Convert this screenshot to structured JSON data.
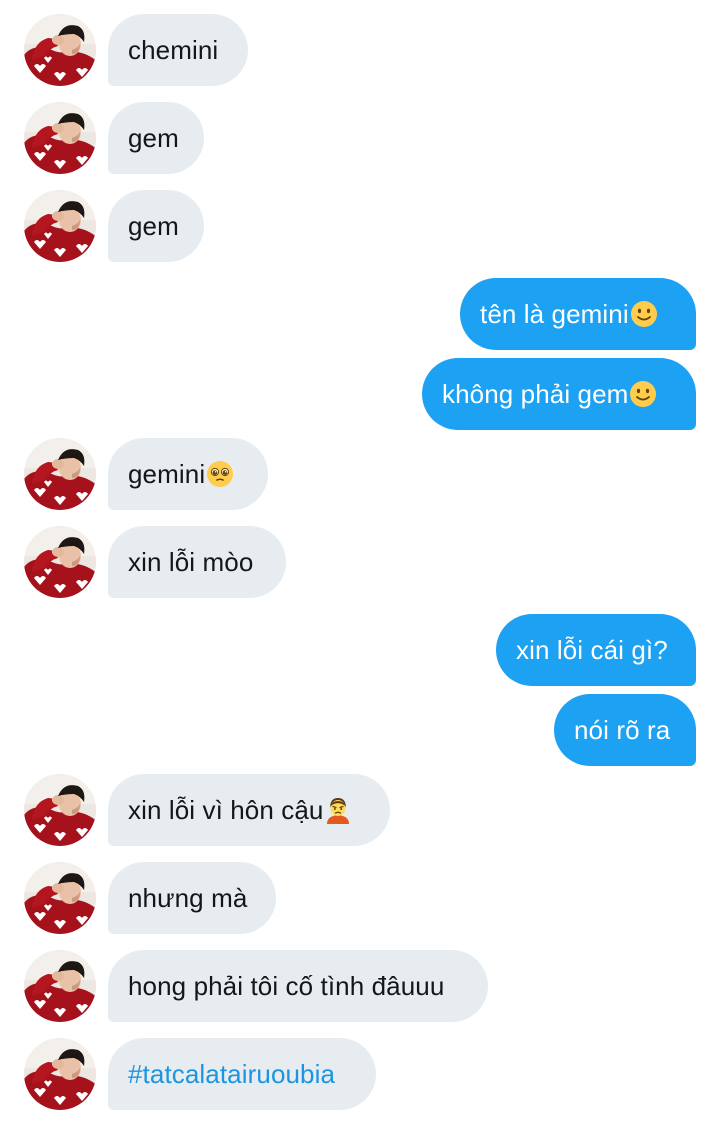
{
  "conversation": {
    "messages": [
      {
        "direction": "received",
        "text": "chemini",
        "emoji": ""
      },
      {
        "direction": "received",
        "text": "gem",
        "emoji": ""
      },
      {
        "direction": "received",
        "text": "gem",
        "emoji": ""
      },
      {
        "direction": "sent",
        "text": "tên là gemini",
        "emoji": "slightly-smiling-face-emoji"
      },
      {
        "direction": "sent",
        "text": "không phải gem",
        "emoji": "slightly-smiling-face-emoji"
      },
      {
        "direction": "received",
        "text": "gemini",
        "emoji": "pleading-face-emoji"
      },
      {
        "direction": "received",
        "text": "xin lỗi mòo",
        "emoji": ""
      },
      {
        "direction": "sent",
        "text": "xin lỗi cái gì?",
        "emoji": ""
      },
      {
        "direction": "sent",
        "text": "nói rõ ra",
        "emoji": ""
      },
      {
        "direction": "received",
        "text": "xin lỗi vì hôn cậu",
        "emoji": "person-pouting-emoji"
      },
      {
        "direction": "received",
        "text": "nhưng mà",
        "emoji": ""
      },
      {
        "direction": "received",
        "text": "hong phải tôi cố tình đâuuu",
        "emoji": ""
      },
      {
        "direction": "received",
        "text": "#tatcalatairuoubia",
        "emoji": "",
        "is_hashtag": true
      }
    ]
  },
  "colors": {
    "sent_bubble": "#1da1f2",
    "received_bubble": "#e6ecf0",
    "received_text": "#14171a",
    "hashtag": "#1b95e0"
  },
  "icons": {
    "avatar": "avatar-icon"
  }
}
